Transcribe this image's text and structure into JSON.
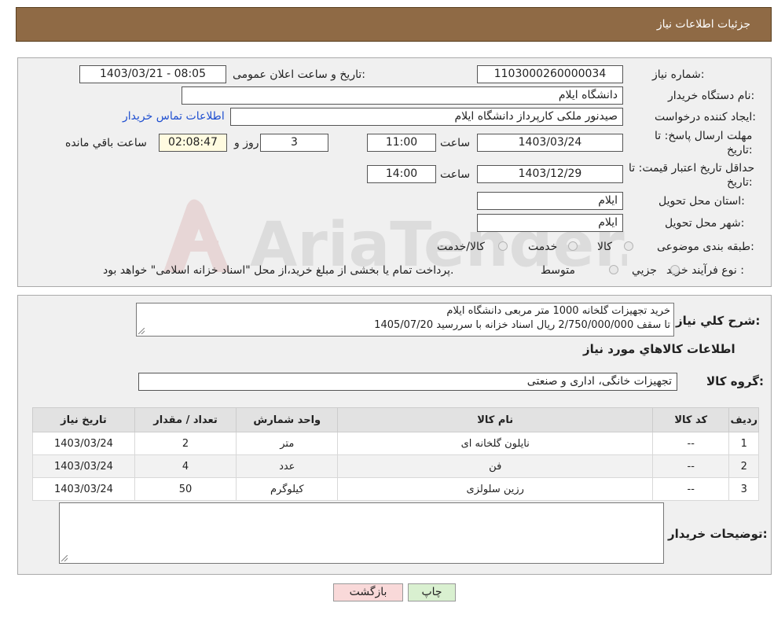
{
  "header": {
    "title": "جزئیات اطلاعات نیاز"
  },
  "fields": {
    "need_number_label": "شماره نیاز:",
    "need_number": "1103000260000034",
    "announce_label": "تاریخ و ساعت اعلان عمومی:",
    "announce_value": "1403/03/21 - 08:05",
    "buyer_org_label": "نام دستگاه خریدار:",
    "buyer_org": "دانشگاه ایلام",
    "creator_label": "ایجاد کننده درخواست:",
    "creator": "صیدنور ملکی کارپرداز دانشگاه ایلام",
    "contact_link": "اطلاعات تماس خریدار",
    "deadline_label_1": "مهلت ارسال پاسخ: تا",
    "deadline_label_2": "تاریخ:",
    "deadline_date": "1403/03/24",
    "time_label": "ساعت",
    "deadline_time": "11:00",
    "days_value": "3",
    "days_label": "روز و",
    "remaining_value": "02:08:47",
    "remaining_label": "ساعت باقي مانده",
    "validity_label_1": "حداقل تاریخ اعتبار قیمت: تا",
    "validity_label_2": "تاریخ:",
    "validity_date": "1403/12/29",
    "validity_time": "14:00",
    "province_label": "استان محل تحویل:",
    "province": "ایلام",
    "city_label": "شهر محل تحویل:",
    "city": "ایلام",
    "category_label": "طبقه بندی موضوعی:",
    "category_options": [
      "کالا",
      "خدمت",
      "کالا/خدمت"
    ],
    "process_label": "نوع فرآیند خرید :",
    "process_options": [
      "جزيي",
      "متوسط"
    ],
    "process_note": "پرداخت تمام یا بخشی از مبلغ خرید،از محل \"اسناد خزانه اسلامی\" خواهد بود."
  },
  "description": {
    "label": "شرح کلي نياز:",
    "line1": "خرید تجهیزات گلخانه 1000 متر مربعی دانشگاه ایلام",
    "line2": "تا سقف 2/750/000/000 ریال  اسناد خزانه با سررسید 1405/07/20"
  },
  "goods": {
    "section_title": "اطلاعات کالاهاي مورد نياز",
    "group_label": "گروه کالا:",
    "group_value": "تجهیزات خانگی، اداری و صنعتی",
    "columns": [
      "رديف",
      "کد کالا",
      "نام کالا",
      "واحد شمارش",
      "تعداد / مقدار",
      "تاریخ نیاز"
    ],
    "rows": [
      {
        "idx": "1",
        "code": "--",
        "name": "نایلون گلخانه ای",
        "unit": "متر",
        "qty": "2",
        "date": "1403/03/24"
      },
      {
        "idx": "2",
        "code": "--",
        "name": "فن",
        "unit": "عدد",
        "qty": "4",
        "date": "1403/03/24"
      },
      {
        "idx": "3",
        "code": "--",
        "name": "رزین سلولزی",
        "unit": "کیلوگرم",
        "qty": "50",
        "date": "1403/03/24"
      }
    ]
  },
  "buyer_notes": {
    "label": "توضیحات خریدار:",
    "value": ""
  },
  "buttons": {
    "print": "چاپ",
    "back": "بازگشت"
  },
  "watermark": {
    "text": "AriaTender.neT"
  },
  "colors": {
    "header_bg": "#8f6a45",
    "panel_bg": "#f0f0f0",
    "link": "#1f4fd0",
    "back_btn_bg": "#f9d9d9",
    "print_btn_bg": "#d9f0d0"
  }
}
